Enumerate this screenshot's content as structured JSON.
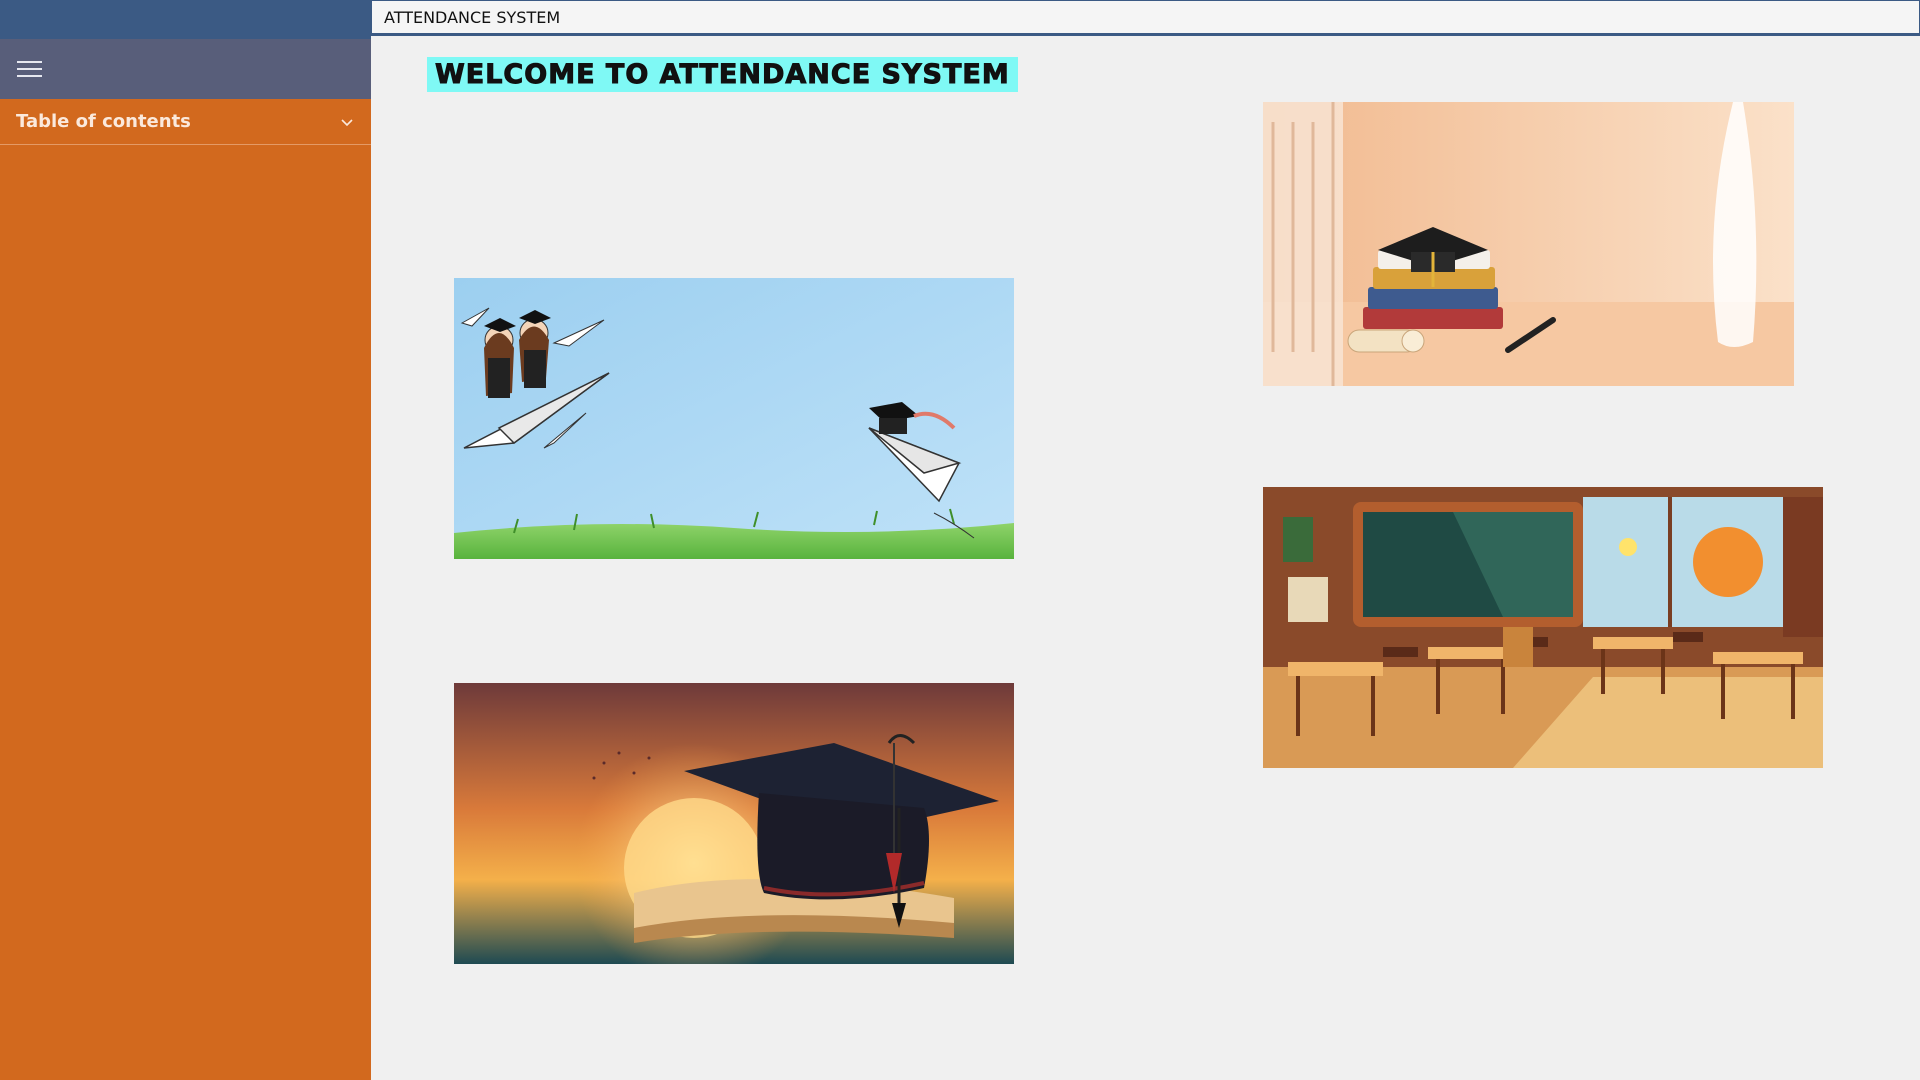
{
  "window": {
    "title": "ATTENDANCE SYSTEM"
  },
  "sidebar": {
    "menu_icon": "hamburger-icon",
    "toc_label": "Table of contents",
    "toc_icon": "chevron-down-icon"
  },
  "main": {
    "heading": "WELCOME TO ATTENDANCE SYSTEM",
    "images": [
      {
        "name": "graduates-paper-plane-image"
      },
      {
        "name": "books-graduation-cap-image"
      },
      {
        "name": "sunset-graduation-cap-image"
      },
      {
        "name": "classroom-image"
      }
    ]
  },
  "colors": {
    "sidebar_bg": "#d2691e",
    "sidebar_top": "#3b5a84",
    "menu_bar": "#585e7a",
    "heading_highlight": "#7ff9f5",
    "page_bg": "#f0f0f0"
  }
}
